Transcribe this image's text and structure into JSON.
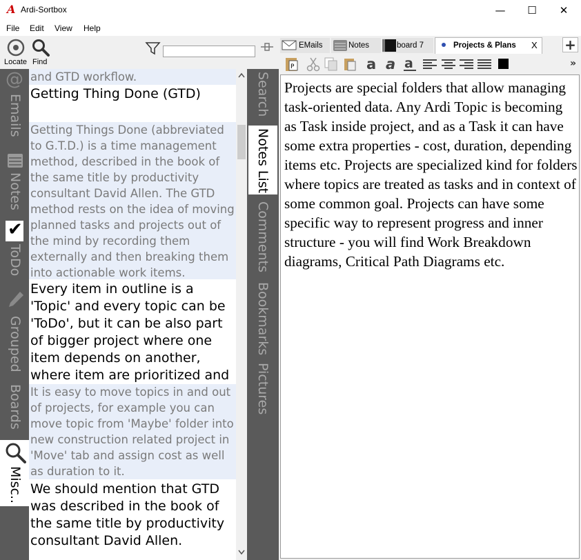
{
  "window": {
    "title": "Ardi-Sortbox",
    "logo_letter": "A",
    "minimize": "—",
    "maximize": "☐",
    "close": "✕"
  },
  "menu": [
    "File",
    "Edit",
    "View",
    "Help"
  ],
  "toolbar": {
    "locate_label": "Locate",
    "find_label": "Find",
    "filter_value": ""
  },
  "left_tabs": {
    "emails": "Emails",
    "notes": "Notes",
    "todo": "ToDo",
    "grouped": "Grouped",
    "boards": "Boards",
    "misc": "Misc.."
  },
  "notes": [
    {
      "kind": "grey",
      "text": "and GTD workflow."
    },
    {
      "kind": "dark",
      "text": "Getting Thing Done (GTD)"
    },
    {
      "kind": "grey",
      "text": "Getting Things Done (abbreviated to G.T.D.) is a time management method, described in the book of the same title by productivity consultant David Allen. The GTD method rests on the idea of moving planned tasks and projects out of the mind by recording them externally and then breaking them into actionable work items."
    },
    {
      "kind": "dark",
      "text": "Every item in outline is a 'Topic' and every topic can be 'ToDo', but it can be also part of bigger project where one item depends on another, where item are prioritized and can"
    },
    {
      "kind": "grey",
      "text": "It is easy to move topics in and out of projects, for example you can move topic from 'Maybe' folder into new construction related project in 'Move' tab and assign cost as well as duration to it."
    },
    {
      "kind": "dark",
      "text": "We should mention that GTD was described in the book of the same title by productivity consultant David Allen."
    }
  ],
  "right_tabs": {
    "search": "Search",
    "notes_list": "Notes List",
    "comments": "Comments",
    "bookmarks": "Bookmarks",
    "pictures": "Pictures"
  },
  "doc_tabs": {
    "emails": "EMails",
    "notes": "Notes",
    "board": "board 7",
    "projects": "Projects & Plans",
    "close": "X",
    "add": "+"
  },
  "format_toolbar": {
    "overflow": "»"
  },
  "editor": {
    "text": "Projects are special folders that allow managing task-oriented data. Any Ardi Topic is becoming as Task inside project, and as a Task it can have some extra properties - cost, duration, depending items etc. Projects are specialized kind for folders where topics are treated as tasks and in context of some common goal. Projects can have some specific way to represent progress and inner structure - you will find Work Breakdown diagrams, Critical Path Diagrams etc."
  }
}
